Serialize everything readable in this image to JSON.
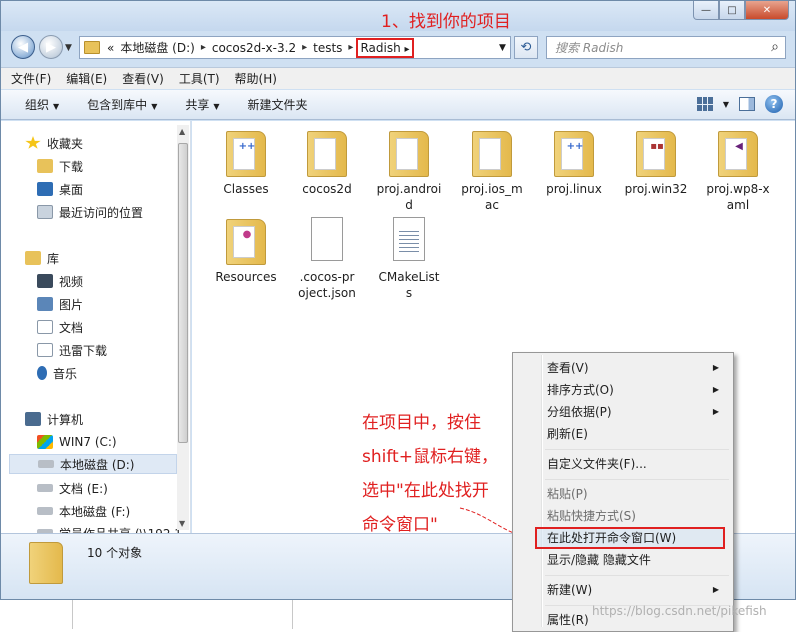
{
  "annotation_top": "1、找到你的项目",
  "annotation_body": [
    "在项目中，按住",
    "shift+鼠标右键，",
    "选中\"在此处找开",
    "命令窗口\""
  ],
  "window_controls": {
    "minimize": "—",
    "maximize": "□",
    "close": "✕"
  },
  "address": {
    "prefix": "«",
    "crumbs": [
      "本地磁盘 (D:)",
      "cocos2d-x-3.2",
      "tests",
      "Radish"
    ],
    "separator": "▸"
  },
  "search": {
    "placeholder": "搜索 Radish"
  },
  "menubar": [
    "文件(F)",
    "编辑(E)",
    "查看(V)",
    "工具(T)",
    "帮助(H)"
  ],
  "toolbar": {
    "organize": "组织",
    "include_library": "包含到库中",
    "share": "共享",
    "new_folder": "新建文件夹"
  },
  "navpane": {
    "favorites": {
      "label": "收藏夹",
      "items": [
        "下载",
        "桌面",
        "最近访问的位置"
      ]
    },
    "libraries": {
      "label": "库",
      "items": [
        "视频",
        "图片",
        "文档",
        "迅雷下载",
        "音乐"
      ]
    },
    "computer": {
      "label": "计算机",
      "items": [
        "WIN7 (C:)",
        "本地磁盘 (D:)",
        "文档 (E:)",
        "本地磁盘 (F:)",
        "学员作品共享 (\\\\192.1"
      ]
    }
  },
  "files": [
    "Classes",
    "cocos2d",
    "proj.androi\nd",
    "proj.ios_m\nac",
    "proj.linux",
    "proj.win32",
    "proj.wp8-x\naml",
    "Resources",
    ".cocos-pr\noject.json",
    "CMakeList\ns"
  ],
  "details": {
    "count_text": "10 个对象"
  },
  "context_menu": {
    "items": [
      "查看(V)",
      "排序方式(O)",
      "分组依据(P)",
      "刷新(E)",
      "自定义文件夹(F)...",
      "粘贴(P)",
      "粘贴快捷方式(S)",
      "在此处打开命令窗口(W)",
      "显示/隐藏 隐藏文件",
      "新建(W)",
      "属性(R)"
    ]
  },
  "watermark": "https://blog.csdn.net/pikefish",
  "colors": {
    "annotation_red": "#e02020",
    "highlight_blue": "#dfe9f5",
    "folder_yellow": "#e4b94c"
  }
}
